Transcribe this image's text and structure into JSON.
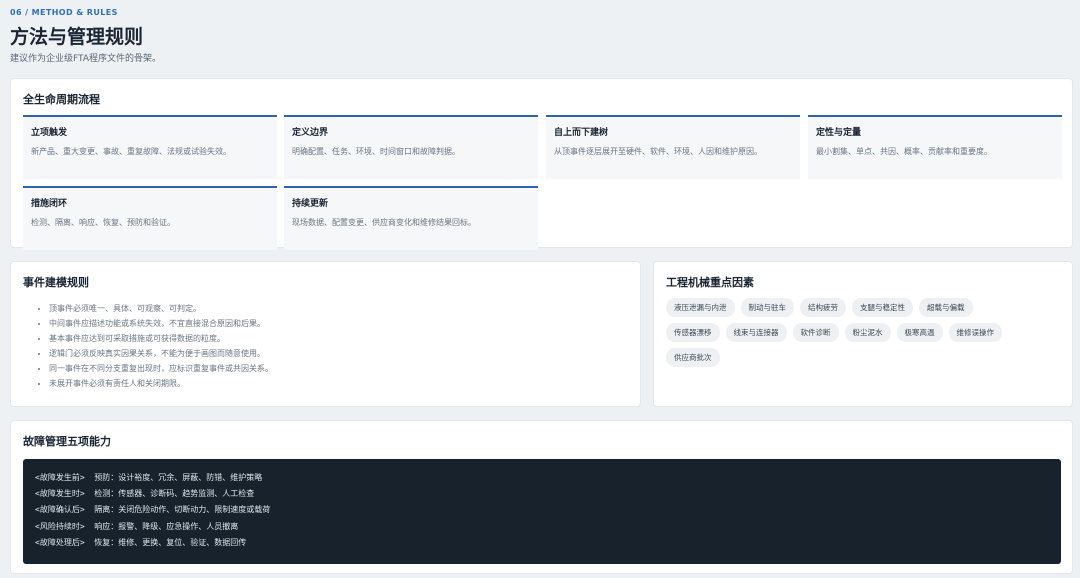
{
  "header": {
    "eyebrow": "06 / METHOD & RULES",
    "title": "方法与管理规则",
    "subtitle": "建议作为企业级FTA程序文件的骨架。"
  },
  "lifecycle": {
    "title": "全生命周期流程",
    "cards": [
      {
        "title": "立项触发",
        "desc": "新产品、重大变更、事故、重复故障、法规或试验失效。"
      },
      {
        "title": "定义边界",
        "desc": "明确配置、任务、环境、时间窗口和故障判据。"
      },
      {
        "title": "自上而下建树",
        "desc": "从顶事件逐层展开至硬件、软件、环境、人因和维护原因。"
      },
      {
        "title": "定性与定量",
        "desc": "最小割集、单点、共因、概率、贡献率和重要度。"
      },
      {
        "title": "措施闭环",
        "desc": "检测、隔离、响应、恢复、预防和验证。"
      },
      {
        "title": "持续更新",
        "desc": "现场数据、配置变更、供应商变化和维修结果回标。"
      }
    ]
  },
  "rules": {
    "title": "事件建模规则",
    "items": [
      "顶事件必须唯一、具体、可观察、可判定。",
      "中间事件应描述功能或系统失效，不宜直接混合原因和后果。",
      "基本事件应达到可采取措施或可获得数据的粒度。",
      "逻辑门必须反映真实因果关系，不能为便于画图而随意使用。",
      "同一事件在不同分支重复出现时，应标识重复事件或共因关系。",
      "未展开事件必须有责任人和关闭期限。"
    ]
  },
  "focus": {
    "title": "工程机械重点因素",
    "tags": [
      "液压泄漏与内泄",
      "制动与驻车",
      "结构疲劳",
      "支腿与稳定性",
      "超载与偏载",
      "传感器漂移",
      "线束与连接器",
      "软件诊断",
      "粉尘泥水",
      "极寒高温",
      "维修误操作",
      "供应商批次"
    ]
  },
  "capabilities": {
    "title": "故障管理五项能力",
    "lines": [
      "<故障发生前>  预防：设计裕度、冗余、屏蔽、防错、维护策略",
      "<故障发生时>  检测：传感器、诊断码、趋势监测、人工检查",
      "<故障确认后>  隔离：关闭危险动作、切断动力、限制速度或载荷",
      "<风险持续时>  响应：报警、降级、应急操作、人员撤离",
      "<故障处理后>  恢复：维修、更换、复位、验证、数据回传"
    ]
  },
  "colors": {
    "accent": "#2c66a8",
    "page_bg": "#eef1f4",
    "code_bg": "#17222d"
  }
}
